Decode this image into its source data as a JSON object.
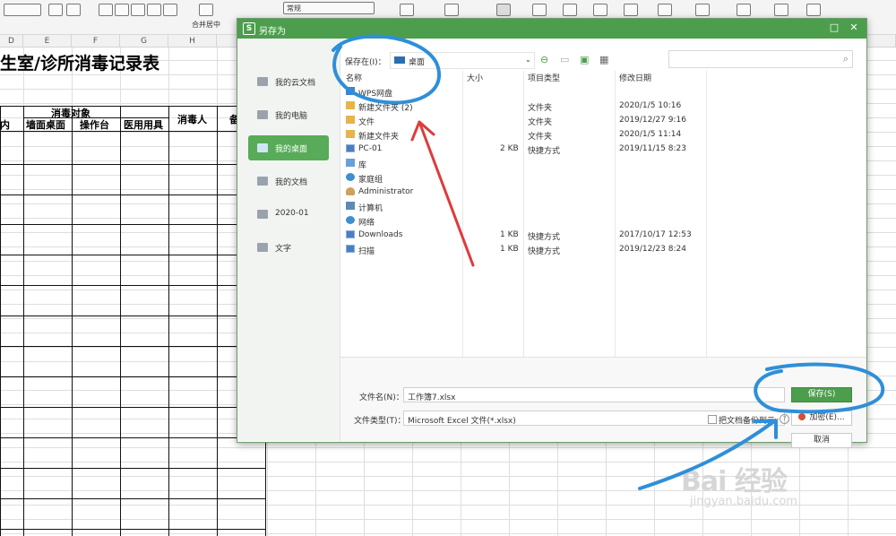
{
  "toolbar": {
    "merge_center_label": "合并居中",
    "number_format_value": "常规"
  },
  "sheet": {
    "columns": [
      "D",
      "E",
      "F",
      "G",
      "H"
    ],
    "title": "生室/诊所消毒记录表",
    "headers": {
      "disinfect_target": "消毒对象",
      "partial_left": "内",
      "wall_desk": "墙面桌面",
      "workbench": "操作台",
      "medical_tools": "医用用具",
      "disinfector": "消毒人",
      "partial_right": "备"
    }
  },
  "dialog": {
    "title": "另存为",
    "sidebar": [
      {
        "label": "我的云文档",
        "active": false
      },
      {
        "label": "我的电脑",
        "active": false
      },
      {
        "label": "我的桌面",
        "active": true
      },
      {
        "label": "我的文档",
        "active": false
      },
      {
        "label": "2020-01",
        "active": false
      },
      {
        "label": "文字",
        "active": false
      }
    ],
    "location_label": "保存在(I)：",
    "location_value": "桌面",
    "columns": {
      "name": "名称",
      "size": "大小",
      "type": "项目类型",
      "modified": "修改日期"
    },
    "files": [
      {
        "icon": "drive",
        "name": "WPS网盘",
        "size": "",
        "type": "",
        "modified": ""
      },
      {
        "icon": "folder",
        "name": "新建文件夹 (2)",
        "size": "",
        "type": "文件夹",
        "modified": "2020/1/5 10:16"
      },
      {
        "icon": "folder",
        "name": "文件",
        "size": "",
        "type": "文件夹",
        "modified": "2019/12/27 9:16"
      },
      {
        "icon": "folder",
        "name": "新建文件夹",
        "size": "",
        "type": "文件夹",
        "modified": "2020/1/5 11:14"
      },
      {
        "icon": "shortcut",
        "name": "PC-01",
        "size": "2 KB",
        "type": "快捷方式",
        "modified": "2019/11/15 8:23"
      },
      {
        "icon": "lib",
        "name": "库",
        "size": "",
        "type": "",
        "modified": ""
      },
      {
        "icon": "net",
        "name": "家庭组",
        "size": "",
        "type": "",
        "modified": ""
      },
      {
        "icon": "user",
        "name": "Administrator",
        "size": "",
        "type": "",
        "modified": ""
      },
      {
        "icon": "comp",
        "name": "计算机",
        "size": "",
        "type": "",
        "modified": ""
      },
      {
        "icon": "net",
        "name": "网络",
        "size": "",
        "type": "",
        "modified": ""
      },
      {
        "icon": "shortcut",
        "name": "Downloads",
        "size": "1 KB",
        "type": "快捷方式",
        "modified": "2017/10/17 12:53"
      },
      {
        "icon": "shortcut",
        "name": "扫描",
        "size": "1 KB",
        "type": "快捷方式",
        "modified": "2019/12/23 8:24"
      }
    ],
    "filename_label": "文件名(N)：",
    "filename_value": "工作簿7.xlsx",
    "filetype_label": "文件类型(T)：",
    "filetype_value": "Microsoft Excel 文件(*.xlsx)",
    "save_button": "保存(S)",
    "encrypt_button": "加密(E)...",
    "cancel_button": "取消",
    "backup_checkbox_label": "把文档备份到云",
    "help_glyph": "?"
  },
  "watermark": {
    "brand": "Bai 经验",
    "site": "jingyan.baidu.com"
  },
  "colors": {
    "dialog_accent": "#4c9e4c",
    "annotation_blue": "#2f8fd8",
    "annotation_red": "#e03a3a"
  }
}
